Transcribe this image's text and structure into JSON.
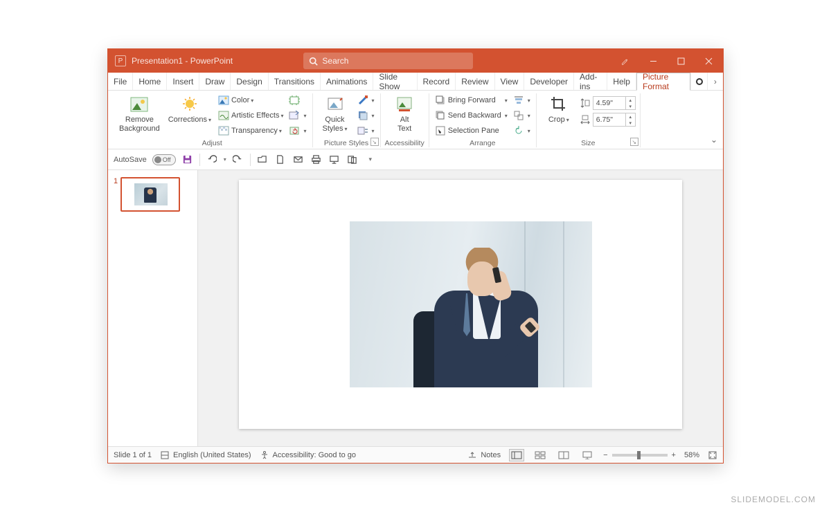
{
  "titlebar": {
    "title": "Presentation1 - PowerPoint",
    "search_placeholder": "Search"
  },
  "window_controls": {
    "minimize": "Minimize",
    "maximize": "Restore",
    "close": "Close"
  },
  "tabs": {
    "file": "File",
    "list": [
      "Home",
      "Insert",
      "Draw",
      "Design",
      "Transitions",
      "Animations",
      "Slide Show",
      "Record",
      "Review",
      "View",
      "Developer",
      "Add-ins",
      "Help",
      "Picture Format"
    ],
    "active": "Picture Format"
  },
  "ribbon": {
    "adjust": {
      "label": "Adjust",
      "remove_bg": "Remove\nBackground",
      "corrections": "Corrections",
      "color": "Color",
      "artistic": "Artistic Effects",
      "transparency": "Transparency"
    },
    "picture_styles": {
      "label": "Picture Styles",
      "quick_styles": "Quick\nStyles"
    },
    "accessibility": {
      "label": "Accessibility",
      "alt_text": "Alt\nText"
    },
    "arrange": {
      "label": "Arrange",
      "bring_forward": "Bring Forward",
      "send_backward": "Send Backward",
      "selection_pane": "Selection Pane"
    },
    "size": {
      "label": "Size",
      "crop": "Crop",
      "height": "4.59\"",
      "width": "6.75\""
    }
  },
  "qat": {
    "autosave_label": "AutoSave",
    "autosave_state": "Off"
  },
  "thumb": {
    "number": "1"
  },
  "status": {
    "slide": "Slide 1 of 1",
    "language": "English (United States)",
    "accessibility": "Accessibility: Good to go",
    "notes": "Notes",
    "zoom": "58%"
  },
  "watermark": "SLIDEMODEL.COM"
}
